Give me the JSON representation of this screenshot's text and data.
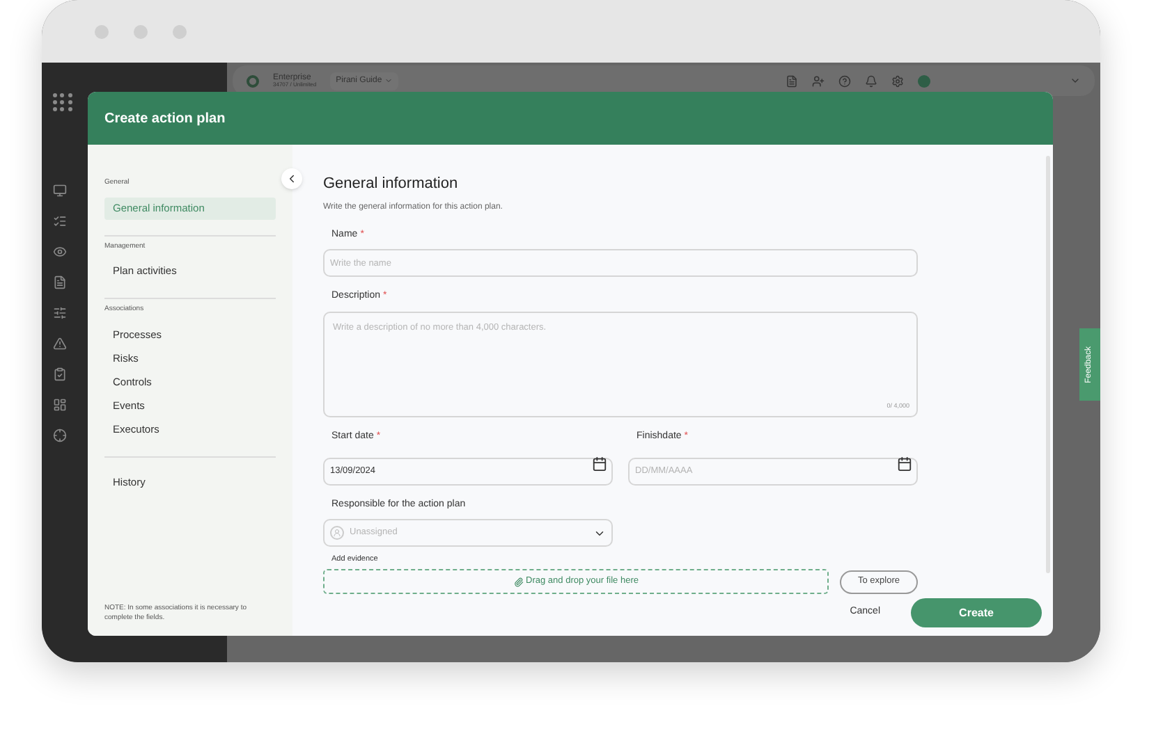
{
  "app_header": {
    "plan": "Enterprise",
    "plan_usage": "34707 / Unlimited",
    "guide": "Pirani Guide"
  },
  "feedback": "Feedback",
  "required_marker": "*",
  "modal": {
    "title": "Create action plan",
    "nav": [
      {
        "heading": "General",
        "items": [
          {
            "label": "General information",
            "selected": true
          }
        ]
      },
      {
        "heading": "Management",
        "items": [
          {
            "label": "Plan activities",
            "selected": false
          }
        ]
      },
      {
        "heading": "Associations",
        "items": [
          {
            "label": "Processes",
            "selected": false
          },
          {
            "label": "Risks",
            "selected": false
          },
          {
            "label": "Controls",
            "selected": false
          },
          {
            "label": "Events",
            "selected": false
          },
          {
            "label": "Executors",
            "selected": false
          }
        ]
      },
      {
        "items": [
          {
            "label": "History",
            "selected": false
          }
        ]
      }
    ],
    "note": "NOTE: In some associations it is necessary to complete the fields.",
    "section_title": "General information",
    "section_subtitle": "Write the general information for this action plan.",
    "name": {
      "label": "Name",
      "required": true,
      "placeholder": "Write the name"
    },
    "description": {
      "label": "Description",
      "required": true,
      "placeholder": "Write a description of no more than 4,000 characters.",
      "counter": "0/ 4,000"
    },
    "start_date": {
      "label": "Start date",
      "required": true,
      "value": "13/09/2024"
    },
    "finish_date": {
      "label": "Finishdate",
      "required": true,
      "placeholder": "DD/MM/AAAA"
    },
    "responsible": {
      "label": "Responsible for the action plan",
      "placeholder": "Unassigned"
    },
    "evidence": {
      "label": "Add evidence",
      "dropzone": "Drag and drop your file here",
      "browse": "To explore"
    },
    "buttons": {
      "cancel": "Cancel",
      "create": "Create"
    }
  }
}
